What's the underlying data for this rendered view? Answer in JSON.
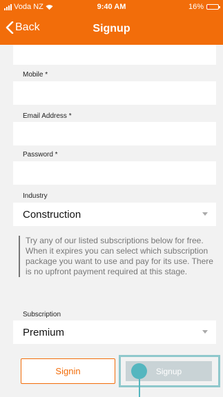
{
  "status_bar": {
    "carrier": "Voda NZ",
    "time": "9:40 AM",
    "battery": "16%",
    "battery_level": 0.16
  },
  "nav": {
    "back_label": "Back",
    "title": "Signup"
  },
  "form": {
    "mobile_label": "Mobile *",
    "mobile_value": "",
    "email_label": "Email Address *",
    "email_value": "",
    "password_label": "Password *",
    "password_value": "",
    "industry_label": "Industry",
    "industry_value": "Construction",
    "note": "Try any of our listed subscriptions below for free. When it expires you can select which subscription package you want to use and pay for its use. There is no upfront payment required at this stage.",
    "subscription_label": "Subscription",
    "subscription_value": "Premium"
  },
  "actions": {
    "signin_label": "Signin",
    "signup_label": "Signup"
  },
  "colors": {
    "accent": "#f26d0a",
    "highlight": "#55b6bf",
    "disabled": "#c9d3d6"
  }
}
